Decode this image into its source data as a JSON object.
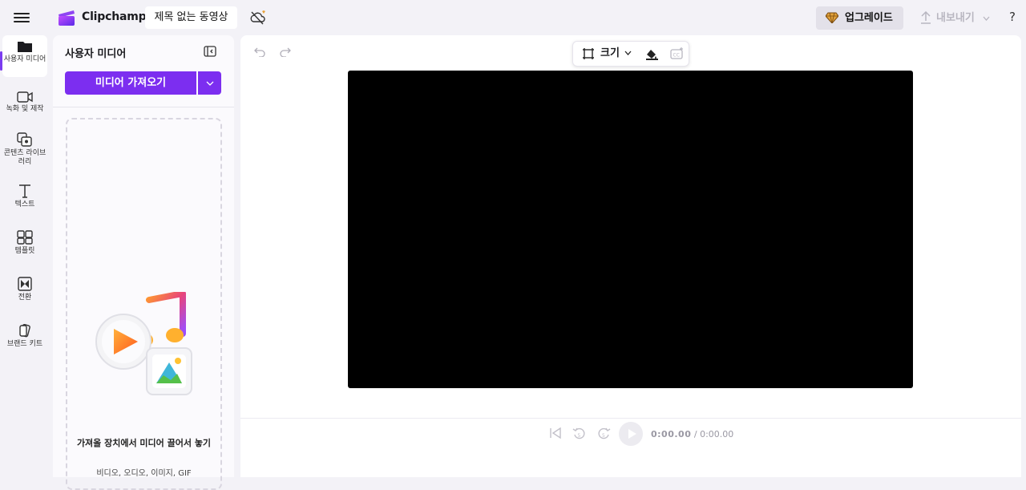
{
  "header": {
    "brand": "Clipchamp",
    "project_title": "제목 없는 동영상",
    "upgrade_label": "업그레이드",
    "export_label": "내보내기",
    "help_label": "?"
  },
  "rail": {
    "items": [
      {
        "label": "사용자 미디어",
        "icon": "folder-icon"
      },
      {
        "label": "녹화 및 제작",
        "icon": "video-camera-icon"
      },
      {
        "label": "콘텐츠 라이브러리",
        "icon": "content-library-icon"
      },
      {
        "label": "텍스트",
        "icon": "text-icon"
      },
      {
        "label": "템플릿",
        "icon": "templates-icon"
      },
      {
        "label": "전환",
        "icon": "transitions-icon"
      },
      {
        "label": "브랜드 키트",
        "icon": "brand-kit-icon"
      }
    ]
  },
  "panel": {
    "title": "사용자 미디어",
    "import_label": "미디어 가져오기",
    "drop_text": "가져올 장치에서 미디어 끌어서 놓기",
    "drop_sub": "비디오, 오디오, 이미지, GIF"
  },
  "canvas": {
    "size_label": "크기"
  },
  "playback": {
    "current_time": "0:00.00",
    "separator": "/",
    "total_time": "0:00.00"
  },
  "colors": {
    "accent": "#7c2ef0",
    "background": "#f3f2f7",
    "video_bg": "#000000"
  }
}
